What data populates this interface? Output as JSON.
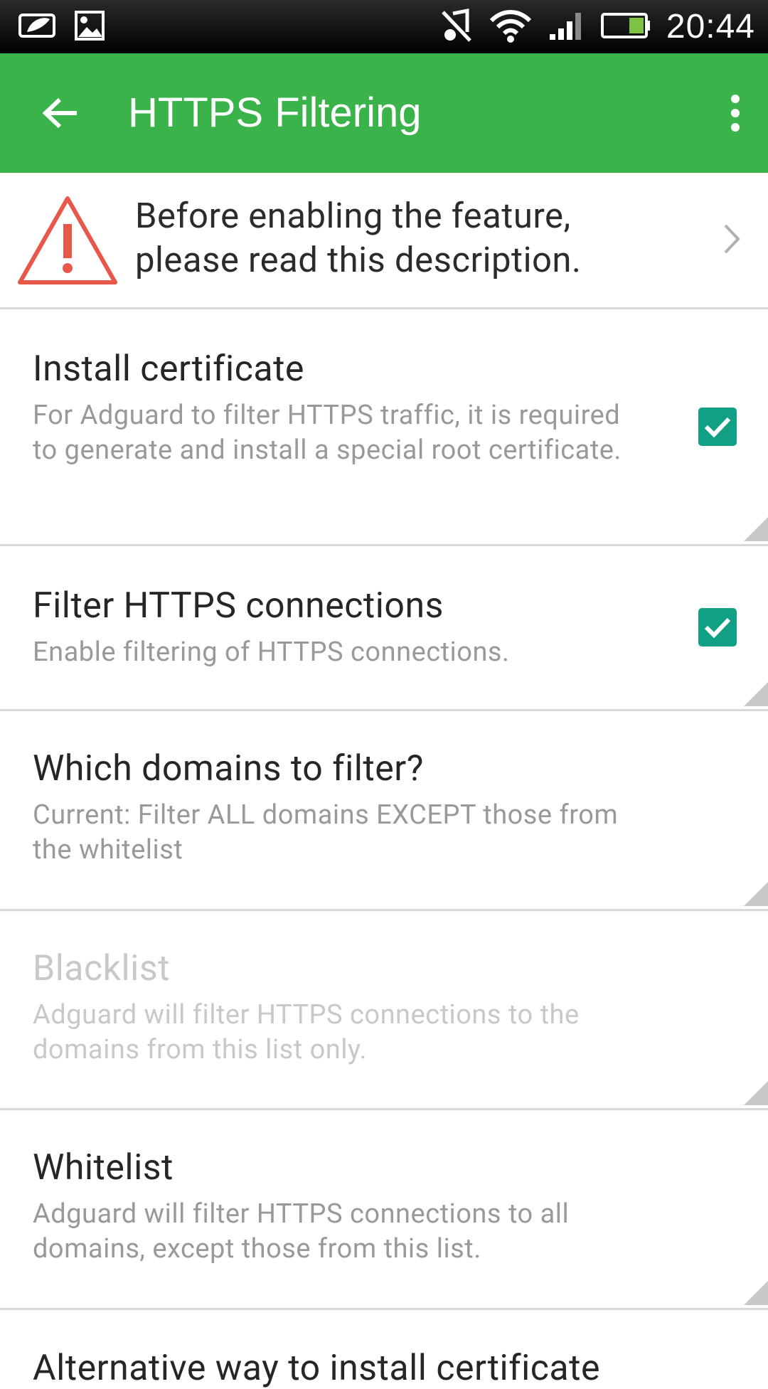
{
  "status_bar": {
    "time": "20:44",
    "icons": [
      "leaf-battery-saver-icon",
      "image-notification-icon",
      "mute-icon",
      "wifi-icon",
      "signal-icon",
      "battery-icon"
    ]
  },
  "app_bar": {
    "title": "HTTPS Filtering",
    "back_icon": "arrow-back-icon",
    "menu_icon": "more-vert-icon",
    "color": "#3ab44a"
  },
  "warning": {
    "text": "Before enabling the feature, please read this description.",
    "icon": "warning-triangle-icon",
    "icon_color": "#e8584a"
  },
  "settings": [
    {
      "title": "Install certificate",
      "summary": "For Adguard to filter HTTPS traffic, it is required to generate and install a special root certificate.",
      "checked": true,
      "enabled": true
    },
    {
      "title": "Filter HTTPS connections",
      "summary": "Enable filtering of HTTPS connections.",
      "checked": true,
      "enabled": true
    },
    {
      "title": "Which domains to filter?",
      "summary": "Current: Filter ALL domains EXCEPT those from the whitelist",
      "enabled": true
    },
    {
      "title": "Blacklist",
      "summary": "Adguard will filter HTTPS connections to the domains from this list only.",
      "enabled": false
    },
    {
      "title": "Whitelist",
      "summary": "Adguard will filter HTTPS connections to all domains, except those from this list.",
      "enabled": true
    }
  ],
  "partial_item": {
    "title": "Alternative way to install certificate"
  },
  "accent_color": "#12a085"
}
